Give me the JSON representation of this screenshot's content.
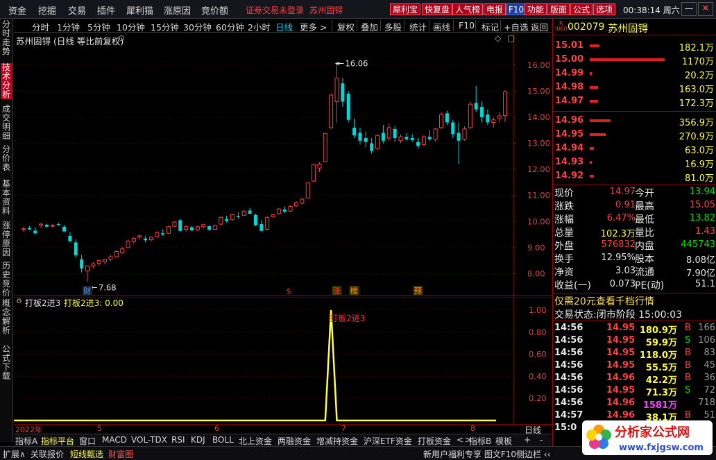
{
  "menu": {
    "items": [
      "资金",
      "挖掘",
      "交易",
      "插件",
      "犀利猫",
      "涨原因",
      "竞价额"
    ],
    "notice": "证券交易未登录",
    "stock_name_title": "苏州固锝",
    "tool_buttons": [
      "犀利宝",
      "快复盘",
      "人气榜",
      "电报",
      "F10",
      "功能",
      "版面",
      "公式",
      "选项"
    ],
    "time": "00:38:14",
    "weekday": "周六"
  },
  "left_tabs": [
    "分时走势",
    "技术分析",
    "成交明细",
    "分价表",
    "基本资料",
    "涨停原因",
    "历史竞价",
    "概念解析",
    "公式下载"
  ],
  "left_tab_active": 1,
  "period_bar": {
    "periods": [
      "分时",
      "1分钟",
      "5分钟",
      "10分钟",
      "15分钟",
      "30分钟",
      "60分钟",
      "2小时",
      "日线",
      "更多 >"
    ],
    "selected": "日线",
    "actions": [
      "复权",
      "叠加",
      "多股",
      "统计",
      "画线",
      "F10",
      "标记",
      "+自选",
      "返回"
    ]
  },
  "main_chart": {
    "title": "苏州固锝 (日线 等比前复权)",
    "high_label": "16.06",
    "low_label": "7.68",
    "event_marks": [
      "财",
      "$",
      "涨",
      "榜",
      "预"
    ]
  },
  "indicator": {
    "name": "打板2进3",
    "value_text": "打板2进3: 0.00",
    "peak_label": "打板2进3"
  },
  "dates": [
    "2022年",
    "5",
    "6",
    "7",
    "8"
  ],
  "date_axis_label": "日线",
  "bottom_tabs": [
    "指标A",
    "指标平台",
    "窗口",
    "MACD",
    "VOL-TDX",
    "RSI",
    "KDJ",
    "BOLL",
    "北上资金",
    "两融资金",
    "增减持资金",
    "沪深ETF资金",
    "打板资金",
    "<",
    ">",
    "指标B",
    "模板",
    "+",
    "-"
  ],
  "status": {
    "left": [
      "扩展∧",
      "关联报价",
      "短线甄选",
      "财富圈"
    ],
    "ticker": "新用户福利专享  图文F10侧边栏 ‹‹"
  },
  "quote": {
    "code": "002079",
    "name": "苏州固锝",
    "badge": "R\nI000",
    "asks": [
      {
        "price": "15.01",
        "vol": "182.1万",
        "bar": 0.09
      },
      {
        "price": "15.00",
        "vol": "1170万",
        "bar": 0.72
      },
      {
        "price": "14.99",
        "vol": "20.2万",
        "bar": 0.02
      },
      {
        "price": "14.98",
        "vol": "163.0万",
        "bar": 0.08
      },
      {
        "price": "14.97",
        "vol": "172.3万",
        "bar": 0.08
      }
    ],
    "bids": [
      {
        "price": "14.96",
        "vol": "356.9万",
        "bar": 0.2
      },
      {
        "price": "14.95",
        "vol": "270.9万",
        "bar": 0.15
      },
      {
        "price": "14.94",
        "vol": "63.0万",
        "bar": 0.04
      },
      {
        "price": "14.93",
        "vol": "16.9万",
        "bar": 0.02
      },
      {
        "price": "14.92",
        "vol": "81.0万",
        "bar": 0.04
      }
    ],
    "stats": [
      {
        "l1": "现价",
        "v1": "14.97",
        "c1": "red",
        "l2": "今开",
        "v2": "13.94",
        "c2": "grn"
      },
      {
        "l1": "涨跌",
        "v1": "0.91",
        "c1": "red",
        "l2": "最高",
        "v2": "15.05",
        "c2": "red"
      },
      {
        "l1": "涨幅",
        "v1": "6.47%",
        "c1": "red",
        "l2": "最低",
        "v2": "13.82",
        "c2": "grn"
      },
      {
        "l1": "总量",
        "v1": "102.3万",
        "c1": "yel",
        "l2": "量比",
        "v2": "1.43",
        "c2": "red"
      },
      {
        "l1": "外盘",
        "v1": "576832",
        "c1": "red",
        "l2": "内盘",
        "v2": "445743",
        "c2": "grn"
      },
      {
        "l1": "换手",
        "v1": "12.95%",
        "c1": "wht",
        "l2": "股本",
        "v2": "8.08亿",
        "c2": "wht"
      },
      {
        "l1": "净资",
        "v1": "3.03",
        "c1": "wht",
        "l2": "流通",
        "v2": "7.90亿",
        "c2": "wht"
      },
      {
        "l1": "收益(一)",
        "v1": "0.073",
        "c1": "wht",
        "l2": "PE(动)",
        "v2": "51.1",
        "c2": "wht"
      }
    ],
    "promo": "仅需20元查看千档行情",
    "trade_status_label": "交易状态:",
    "trade_status_value": "闭市阶段 15:00:03",
    "ticks": [
      {
        "time": "14:56",
        "price": "14.95",
        "vol": "180.9万",
        "side": "B",
        "n": "166",
        "pc": "red",
        "vc": "yel"
      },
      {
        "time": "14:56",
        "price": "14.95",
        "vol": "59.9万",
        "side": "S",
        "n": "106",
        "pc": "red",
        "vc": "yel"
      },
      {
        "time": "14:56",
        "price": "14.95",
        "vol": "118.0万",
        "side": "B",
        "n": "83",
        "pc": "red",
        "vc": "yel"
      },
      {
        "time": "14:56",
        "price": "14.95",
        "vol": "55.5万",
        "side": "B",
        "n": "45",
        "pc": "red",
        "vc": "yel"
      },
      {
        "time": "14:56",
        "price": "14.96",
        "vol": "42.2万",
        "side": "B",
        "n": "36",
        "pc": "red",
        "vc": "yel"
      },
      {
        "time": "14:56",
        "price": "14.95",
        "vol": "71.3万",
        "side": "S",
        "n": "72",
        "pc": "red",
        "vc": "yel"
      },
      {
        "time": "14:56",
        "price": "14.96",
        "vol": "1581万",
        "side": "",
        "n": "718",
        "pc": "red",
        "vc": "mag"
      },
      {
        "time": "14:57",
        "price": "14.96",
        "vol": "38.1万",
        "side": "B",
        "n": "51",
        "pc": "red",
        "vc": "yel"
      },
      {
        "time": "15:0",
        "price": "",
        "vol": "",
        "side": "",
        "n": "",
        "pc": "red",
        "vc": "yel"
      }
    ]
  },
  "watermark": {
    "line1": "分析家公式网",
    "line2": "www.fxjgsw.com"
  },
  "colors": {
    "up": "#ff3b3b",
    "down": "#00d8d8",
    "grid": "#a00000",
    "indicator": "#ffff40"
  }
}
